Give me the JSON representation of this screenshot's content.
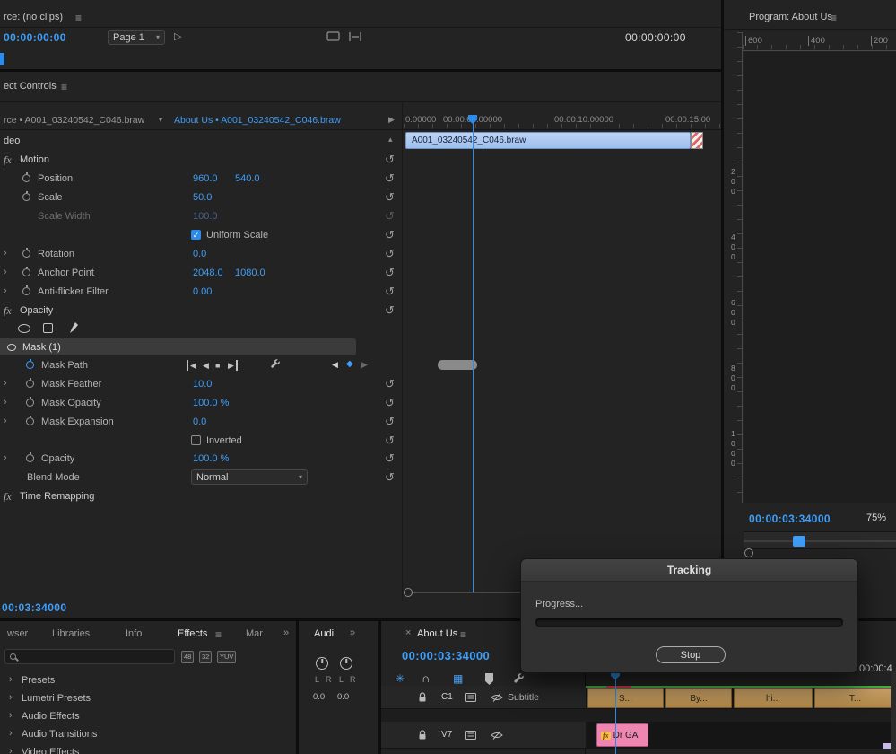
{
  "icons": {
    "menu": "≡",
    "dropdown": "▾",
    "play": "▷",
    "reset": "↺",
    "twirl": "›",
    "check": "✓",
    "chevrons": "»",
    "close": "×",
    "arrow_right": "▶",
    "collapse": "▴",
    "snap": "∩",
    "star": "✳",
    "grid": "▦",
    "kf_prev": "◀",
    "kf_add": "◆",
    "kf_next": "▶",
    "trk_back1": "◀",
    "trk_back": "◀",
    "trk_stop": "■",
    "trk_fwd1": "▶"
  },
  "source_panel": {
    "title": "rce: (no clips)",
    "timecode": "00:00:00:00",
    "page": "Page 1",
    "duration": "00:00:00:00"
  },
  "program_panel": {
    "title": "Program: About Us",
    "ruler_top": [
      "600",
      "400",
      "200"
    ],
    "ruler_side": [
      "200",
      "400",
      "600",
      "800",
      "1000"
    ],
    "timecode": "00:00:03:34000",
    "zoom": "75%"
  },
  "ec": {
    "title": "ect Controls",
    "tab_source": "rce • A001_03240542_C046.braw",
    "tab_sequence": "About Us • A001_03240542_C046.braw",
    "video_section": "deo",
    "motion": "Motion",
    "position": "Position",
    "position_x": "960.0",
    "position_y": "540.0",
    "scale": "Scale",
    "scale_v": "50.0",
    "scale_width": "Scale Width",
    "scale_width_v": "100.0",
    "uniform_scale": "Uniform Scale",
    "rotation": "Rotation",
    "rotation_v": "0.0",
    "anchor": "Anchor Point",
    "anchor_x": "2048.0",
    "anchor_y": "1080.0",
    "antiflicker": "Anti-flicker Filter",
    "antiflicker_v": "0.00",
    "opacity_fx": "Opacity",
    "mask_group": "Mask (1)",
    "mask_path": "Mask Path",
    "mask_feather": "Mask Feather",
    "mask_feather_v": "10.0",
    "mask_opacity": "Mask Opacity",
    "mask_opacity_v": "100.0 %",
    "mask_expansion": "Mask Expansion",
    "mask_expansion_v": "0.0",
    "inverted": "Inverted",
    "opacity": "Opacity",
    "opacity_v": "100.0 %",
    "blend_mode": "Blend Mode",
    "blend_mode_v": "Normal",
    "time_remapping": "Time Remapping",
    "ruler": [
      "0:00000",
      "00:00:05:00000",
      "00:00:10:00000",
      "00:00:15:00"
    ],
    "clip_name": "A001_03240542_C046.braw",
    "bottom_timecode": "00:03:34000"
  },
  "tracking_dialog": {
    "title": "Tracking",
    "progress_label": "Progress...",
    "stop_label": "Stop"
  },
  "effects_panel": {
    "tab_browser": "wser",
    "tab_libraries": "Libraries",
    "tab_info": "Info",
    "tab_effects": "Effects",
    "tab_markers": "Mar",
    "badges": [
      "48",
      "32",
      "YUV"
    ],
    "items": [
      "Presets",
      "Lumetri Presets",
      "Audio Effects",
      "Audio Transitions",
      "Video Effects"
    ]
  },
  "audio_panel": {
    "tab": "Audi",
    "channels": [
      "L",
      "R",
      "L",
      "R"
    ],
    "values": [
      "0.0",
      "0.0"
    ]
  },
  "timeline": {
    "tab": "About Us",
    "timecode": "00:00:03:34000",
    "end_timecode": "00:00:4",
    "caption_track": "C1",
    "caption_label": "Subtitle",
    "video_track": "V7",
    "caption_clips": [
      "S...",
      "By...",
      "hi...",
      "T..."
    ],
    "pink_clip_badge": "fx",
    "pink_clip_name": "Dr GA"
  }
}
